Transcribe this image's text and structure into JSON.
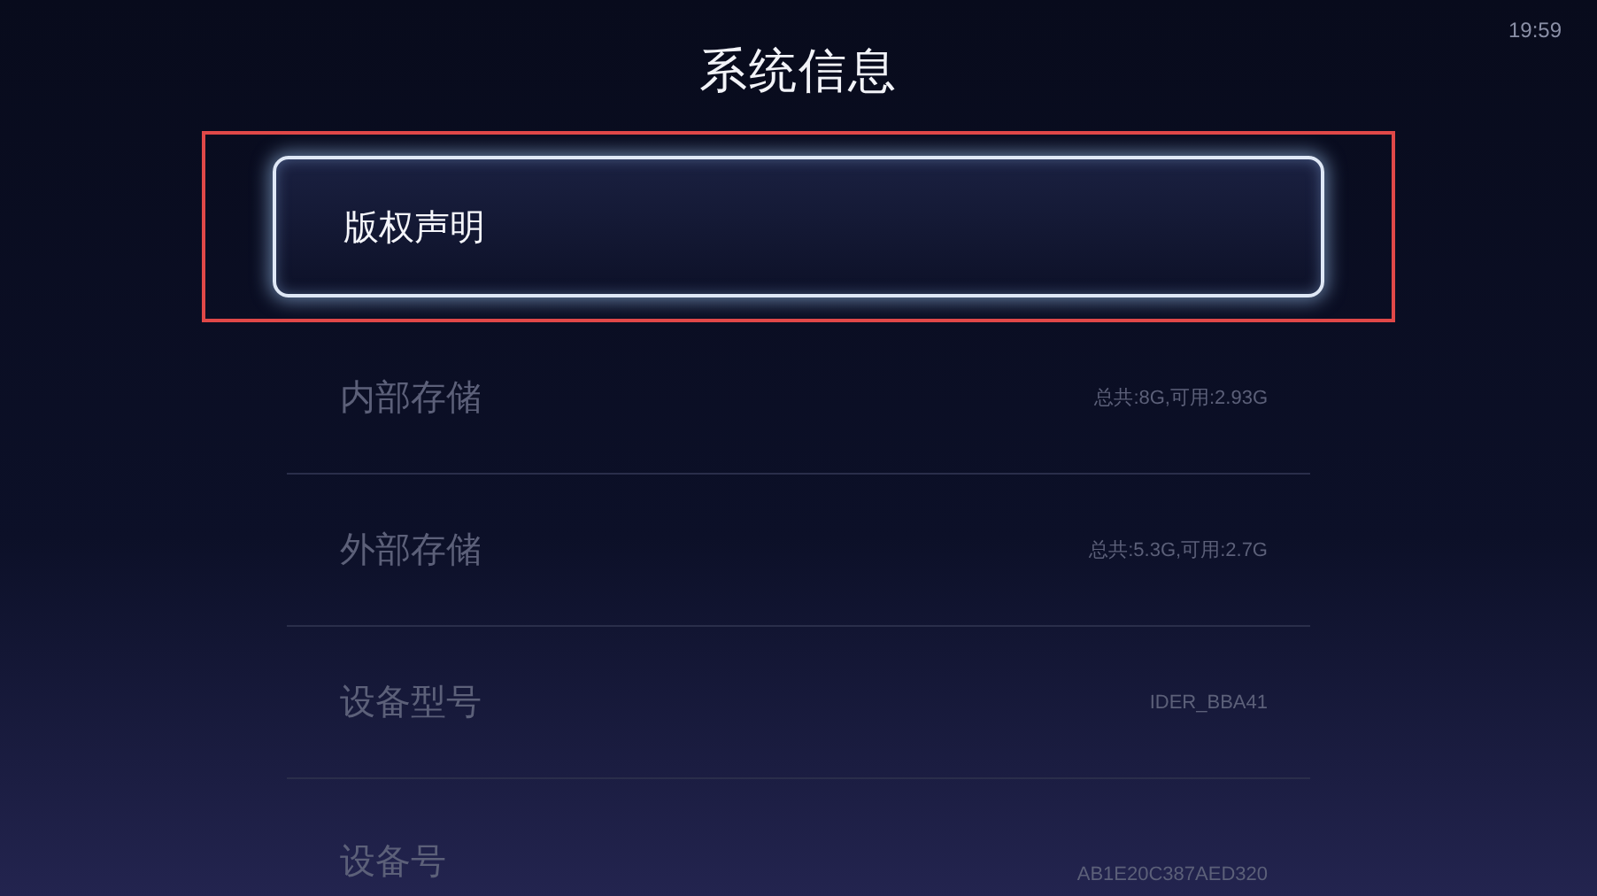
{
  "status_bar": {
    "time": "19:59"
  },
  "title": "系统信息",
  "items": [
    {
      "label": "版权声明",
      "value": "",
      "selected": true
    },
    {
      "label": "内部存储",
      "value": "总共:8G,可用:2.93G",
      "selected": false
    },
    {
      "label": "外部存储",
      "value": "总共:5.3G,可用:2.7G",
      "selected": false
    },
    {
      "label": "设备型号",
      "value": "IDER_BBA41",
      "selected": false
    },
    {
      "label": "设备号",
      "value": "AB1E20C387AED320",
      "selected": false
    }
  ]
}
